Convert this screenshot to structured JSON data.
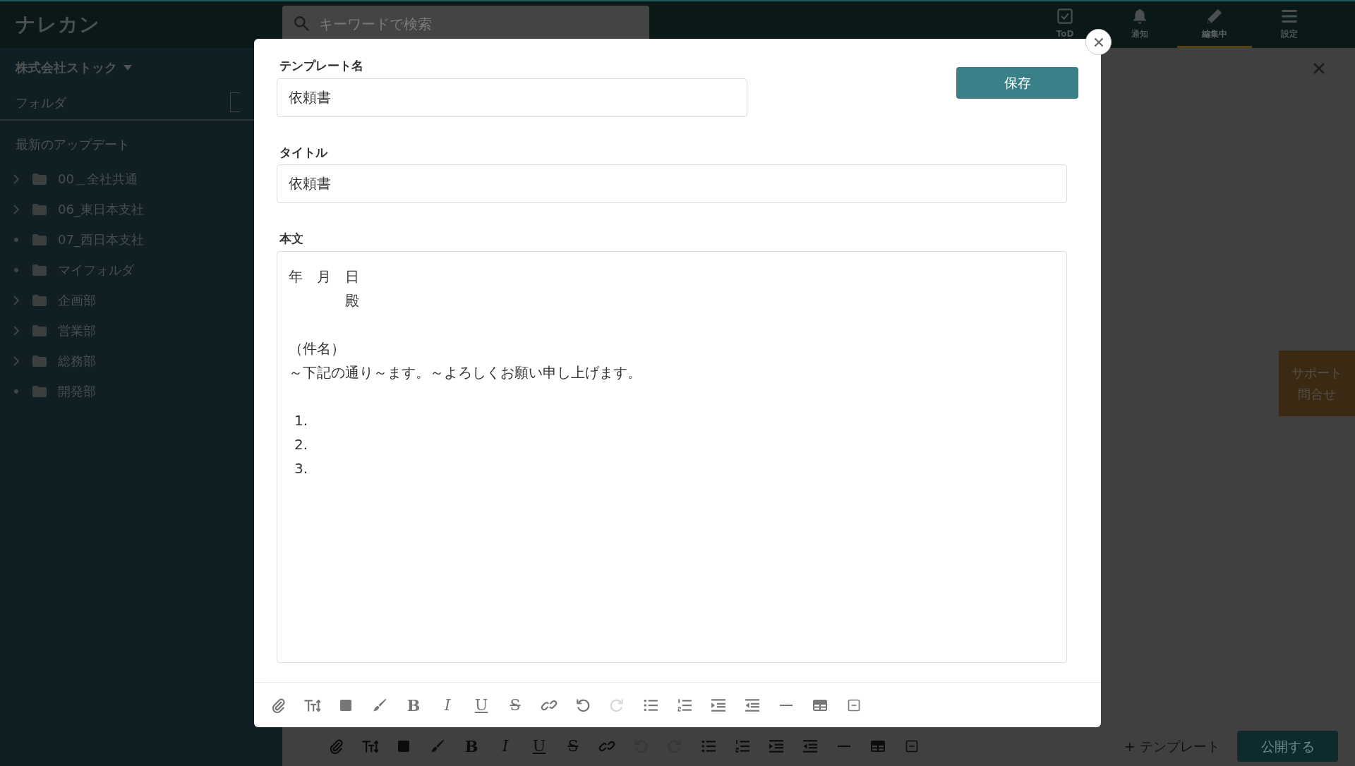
{
  "app": {
    "logo": "ナレカン",
    "search": {
      "placeholder": "キーワードで検索"
    }
  },
  "top_nav": [
    {
      "label": "ToD",
      "kind": "todo",
      "selected": false
    },
    {
      "label": "通知",
      "kind": "bell",
      "selected": false
    },
    {
      "label": "編集中",
      "kind": "pencil",
      "selected": true
    },
    {
      "label": "設定",
      "kind": "menu",
      "selected": false
    }
  ],
  "sidebar": {
    "company": "株式会社ストック",
    "folder_heading": "フォルダ",
    "recent": "最新のアップデート",
    "folders": [
      {
        "label": "00＿全社共通",
        "expandable": true
      },
      {
        "label": "06_東日本支社",
        "expandable": true
      },
      {
        "label": "07_西日本支社",
        "expandable": false
      },
      {
        "label": "マイフォルダ",
        "expandable": false
      },
      {
        "label": "企画部",
        "expandable": true
      },
      {
        "label": "営業部",
        "expandable": true
      },
      {
        "label": "総務部",
        "expandable": true
      },
      {
        "label": "開発部",
        "expandable": false
      }
    ]
  },
  "support_button": [
    "サポート",
    "問合せ"
  ],
  "editor_toolbar": [
    {
      "kind": "attach",
      "disabled": false
    },
    {
      "kind": "textsize",
      "disabled": false
    },
    {
      "kind": "color",
      "disabled": false
    },
    {
      "kind": "highlight",
      "disabled": false
    },
    {
      "kind": "bold",
      "text": "B",
      "disabled": false
    },
    {
      "kind": "italic",
      "text": "I",
      "disabled": false
    },
    {
      "kind": "underline",
      "text": "U",
      "disabled": false
    },
    {
      "kind": "strike",
      "text": "S",
      "disabled": false
    },
    {
      "kind": "link",
      "disabled": false
    },
    {
      "kind": "undo",
      "disabled": true
    },
    {
      "kind": "redo",
      "disabled": true
    },
    {
      "kind": "bullets",
      "disabled": false
    },
    {
      "kind": "numbers",
      "disabled": false
    },
    {
      "kind": "indent",
      "disabled": false
    },
    {
      "kind": "outdent",
      "disabled": false
    },
    {
      "kind": "rule",
      "disabled": false
    },
    {
      "kind": "table",
      "disabled": false
    },
    {
      "kind": "collapse",
      "disabled": false
    }
  ],
  "editor_footer": {
    "template_link": "+ テンプレート",
    "publish_button": "公開する"
  },
  "modal": {
    "name_label": "テンプレート名",
    "name_value": "依頼書",
    "save_button": "保存",
    "title_label": "タイトル",
    "title_value": "依頼書",
    "body_label": "本文",
    "body": [
      {
        "kind": "text",
        "text": "年　月　日"
      },
      {
        "kind": "text",
        "text": "　　　　殿"
      },
      {
        "kind": "blank"
      },
      {
        "kind": "text",
        "text": "（件名）"
      },
      {
        "kind": "text",
        "text": "～下記の通り～ます。～よろしくお願い申し上げます。"
      },
      {
        "kind": "blank"
      },
      {
        "kind": "numbered",
        "text": "1."
      },
      {
        "kind": "numbered",
        "text": "2."
      },
      {
        "kind": "numbered",
        "text": "3."
      }
    ],
    "toolbar": [
      {
        "kind": "attach",
        "disabled": false
      },
      {
        "kind": "textsize",
        "disabled": false
      },
      {
        "kind": "color",
        "disabled": false
      },
      {
        "kind": "highlight",
        "disabled": false
      },
      {
        "kind": "bold",
        "text": "B",
        "disabled": false
      },
      {
        "kind": "italic",
        "text": "I",
        "disabled": false
      },
      {
        "kind": "underline",
        "text": "U",
        "disabled": false
      },
      {
        "kind": "strike",
        "text": "S",
        "disabled": false
      },
      {
        "kind": "link",
        "disabled": false
      },
      {
        "kind": "undo",
        "disabled": false
      },
      {
        "kind": "redo",
        "disabled": true
      },
      {
        "kind": "bullets",
        "disabled": false
      },
      {
        "kind": "numbers",
        "disabled": false
      },
      {
        "kind": "indent",
        "disabled": false
      },
      {
        "kind": "outdent",
        "disabled": false
      },
      {
        "kind": "rule",
        "disabled": false
      },
      {
        "kind": "table",
        "disabled": false
      },
      {
        "kind": "collapse",
        "disabled": false
      }
    ]
  }
}
